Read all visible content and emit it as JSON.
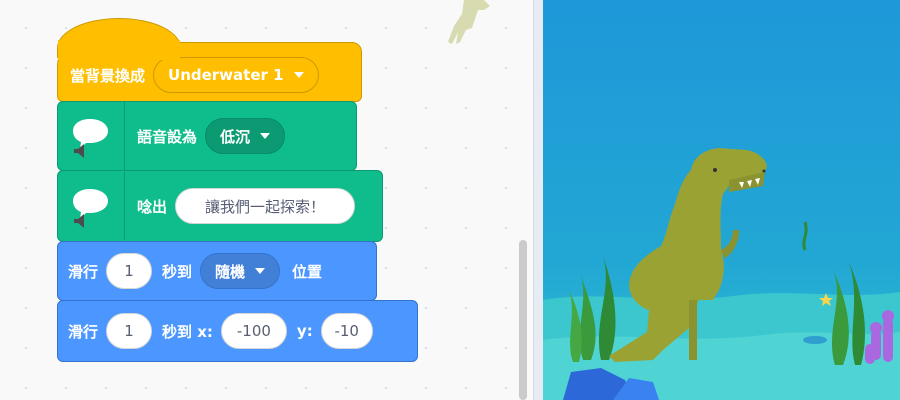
{
  "hat_block": {
    "label": "當背景換成",
    "backdrop_value": "Underwater 1",
    "color": "#ffbf00"
  },
  "voice_block": {
    "label": "語音設為",
    "voice_value": "低沉",
    "icon": "speech-bubble-speaker-icon",
    "color": "#0fbd8c"
  },
  "speak_block": {
    "label": "唸出",
    "text_value": "讓我們一起探索！",
    "icon": "speech-bubble-speaker-icon"
  },
  "glide_random_block": {
    "label_start": "滑行",
    "seconds_value": "1",
    "label_mid": "秒到",
    "target_value": "隨機",
    "label_end": "位置",
    "color": "#4c97ff"
  },
  "glide_xy_block": {
    "label_start": "滑行",
    "seconds_value": "1",
    "label_mid": "秒到 x:",
    "x_value": "-100",
    "label_y": "y:",
    "y_value": "-10"
  },
  "stage": {
    "backdrop": "underwater",
    "sprite": "dinosaur-icon"
  }
}
